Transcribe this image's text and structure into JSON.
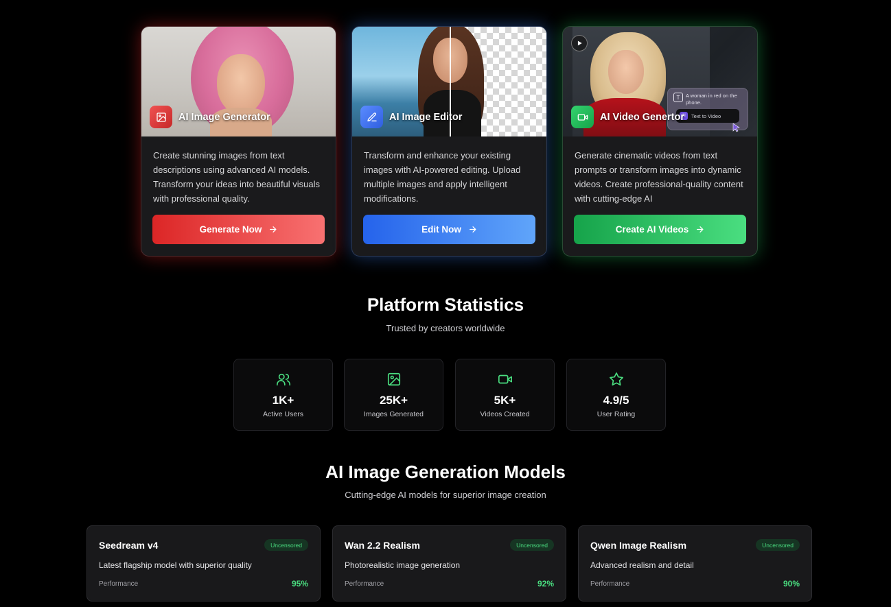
{
  "tools": [
    {
      "title": "AI Image Generator",
      "icon": "image-icon",
      "description": "Create stunning images from text descriptions using advanced AI models. Transform your ideas into beautiful visuals with professional quality.",
      "cta": "Generate Now",
      "accent": "#dc2626"
    },
    {
      "title": "AI Image Editor",
      "icon": "pencil-icon",
      "description": "Transform and enhance your existing images with AI-powered editing. Upload multiple images and apply intelligent modifications.",
      "cta": "Edit Now",
      "accent": "#2563eb"
    },
    {
      "title": "AI Video Genertor",
      "icon": "video-icon",
      "description": "Generate cinematic videos from text prompts or transform images into dynamic videos. Create professional-quality content with cutting-edge AI",
      "cta": "Create AI Videos",
      "accent": "#16a34a",
      "prompt_preview": "A woman in red on the phone.",
      "pill_label": "Text to Video",
      "pill_ai": "AI"
    }
  ],
  "stats_section": {
    "title": "Platform Statistics",
    "subtitle": "Trusted by creators worldwide",
    "items": [
      {
        "value": "1K+",
        "label": "Active Users",
        "icon": "users-icon"
      },
      {
        "value": "25K+",
        "label": "Images Generated",
        "icon": "image-icon"
      },
      {
        "value": "5K+",
        "label": "Videos Created",
        "icon": "video-icon"
      },
      {
        "value": "4.9/5",
        "label": "User Rating",
        "icon": "star-icon"
      }
    ]
  },
  "models_section": {
    "title": "AI Image Generation Models",
    "subtitle": "Cutting-edge AI models for superior image creation",
    "items": [
      {
        "name": "Seedream v4",
        "badge": "Uncensored",
        "description": "Latest flagship model with superior quality",
        "perf_label": "Performance",
        "perf_value": "95%"
      },
      {
        "name": "Wan 2.2 Realism",
        "badge": "Uncensored",
        "description": "Photorealistic image generation",
        "perf_label": "Performance",
        "perf_value": "92%"
      },
      {
        "name": "Qwen Image Realism",
        "badge": "Uncensored",
        "description": "Advanced realism and detail",
        "perf_label": "Performance",
        "perf_value": "90%"
      }
    ]
  },
  "colors": {
    "background": "#000000",
    "card": "#1a1a1c",
    "stat_accent": "#4ade80"
  }
}
